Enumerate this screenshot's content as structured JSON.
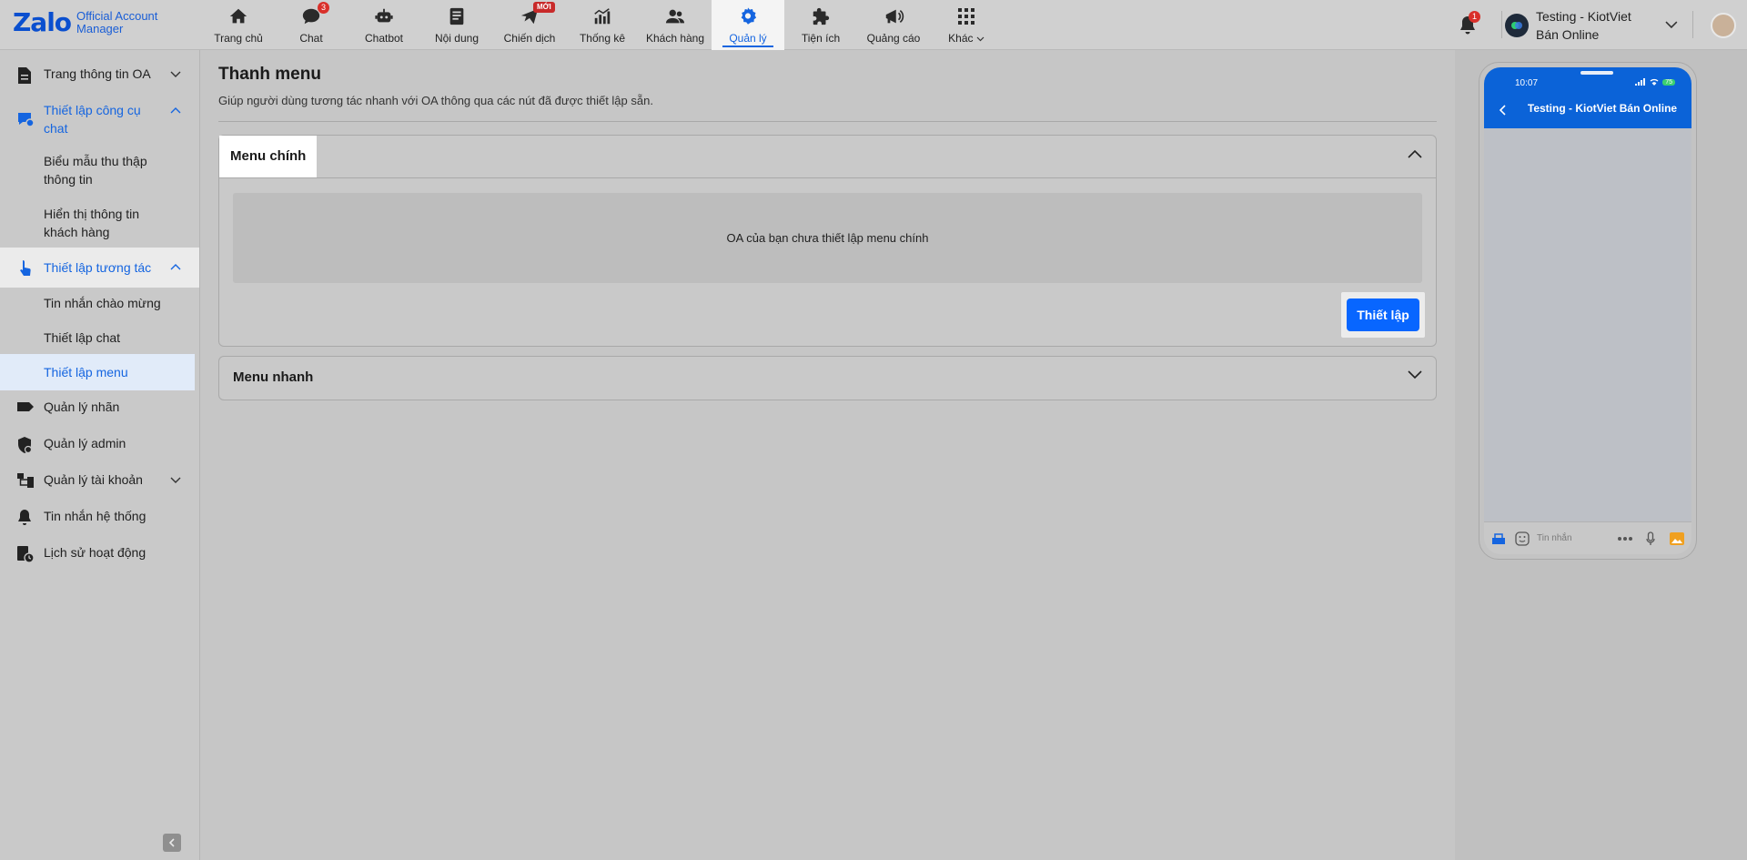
{
  "brand": {
    "logo": "Zalo",
    "sub_line1": "Official Account",
    "sub_line2": "Manager"
  },
  "nav": [
    {
      "label": "Trang chủ",
      "icon": "home-icon"
    },
    {
      "label": "Chat",
      "icon": "chat-icon",
      "badge": "3"
    },
    {
      "label": "Chatbot",
      "icon": "chatbot-icon"
    },
    {
      "label": "Nội dung",
      "icon": "content-icon"
    },
    {
      "label": "Chiến dịch",
      "icon": "campaign-icon",
      "badge": "MỚI"
    },
    {
      "label": "Thống kê",
      "icon": "stats-icon"
    },
    {
      "label": "Khách hàng",
      "icon": "customers-icon"
    },
    {
      "label": "Quản lý",
      "icon": "gear-icon",
      "active": true
    },
    {
      "label": "Tiện ích",
      "icon": "puzzle-icon"
    },
    {
      "label": "Quảng cáo",
      "icon": "ads-icon"
    },
    {
      "label": "Khác",
      "icon": "apps-grid-icon"
    }
  ],
  "topright": {
    "notification_count": "1",
    "account_name": "Testing - KiotViet Bán Online"
  },
  "sidebar": {
    "items": [
      {
        "label": "Trang thông tin OA",
        "icon": "document-icon"
      },
      {
        "label": "Thiết lập công cụ chat",
        "icon": "chat-tools-icon"
      },
      {
        "label": "Biểu mẫu thu thập thông tin"
      },
      {
        "label": "Hiển thị thông tin khách hàng"
      },
      {
        "label": "Thiết lập tương tác",
        "icon": "tap-icon"
      },
      {
        "label": "Tin nhắn chào mừng"
      },
      {
        "label": "Thiết lập chat"
      },
      {
        "label": "Thiết lập menu"
      },
      {
        "label": "Quản lý nhãn",
        "icon": "tag-icon"
      },
      {
        "label": "Quản lý admin",
        "icon": "shield-icon"
      },
      {
        "label": "Quản lý tài khoản",
        "icon": "hierarchy-icon"
      },
      {
        "label": "Tin nhắn hệ thống",
        "icon": "bell-icon"
      },
      {
        "label": "Lịch sử hoạt động",
        "icon": "history-icon"
      }
    ]
  },
  "page": {
    "title": "Thanh menu",
    "description": "Giúp người dùng tương tác nhanh với OA thông qua các nút đã được thiết lập sẵn."
  },
  "menu_main": {
    "title": "Menu chính",
    "empty_text": "OA của bạn chưa thiết lập menu chính",
    "button": "Thiết lập"
  },
  "menu_quick": {
    "title": "Menu nhanh"
  },
  "preview": {
    "time": "10:07",
    "battery": "75",
    "title": "Testing - KiotViet Bán Online",
    "input_placeholder": "Tin nhắn"
  },
  "colors": {
    "accent": "#1565e0",
    "button": "#0866ff",
    "badge": "#d9302a"
  }
}
